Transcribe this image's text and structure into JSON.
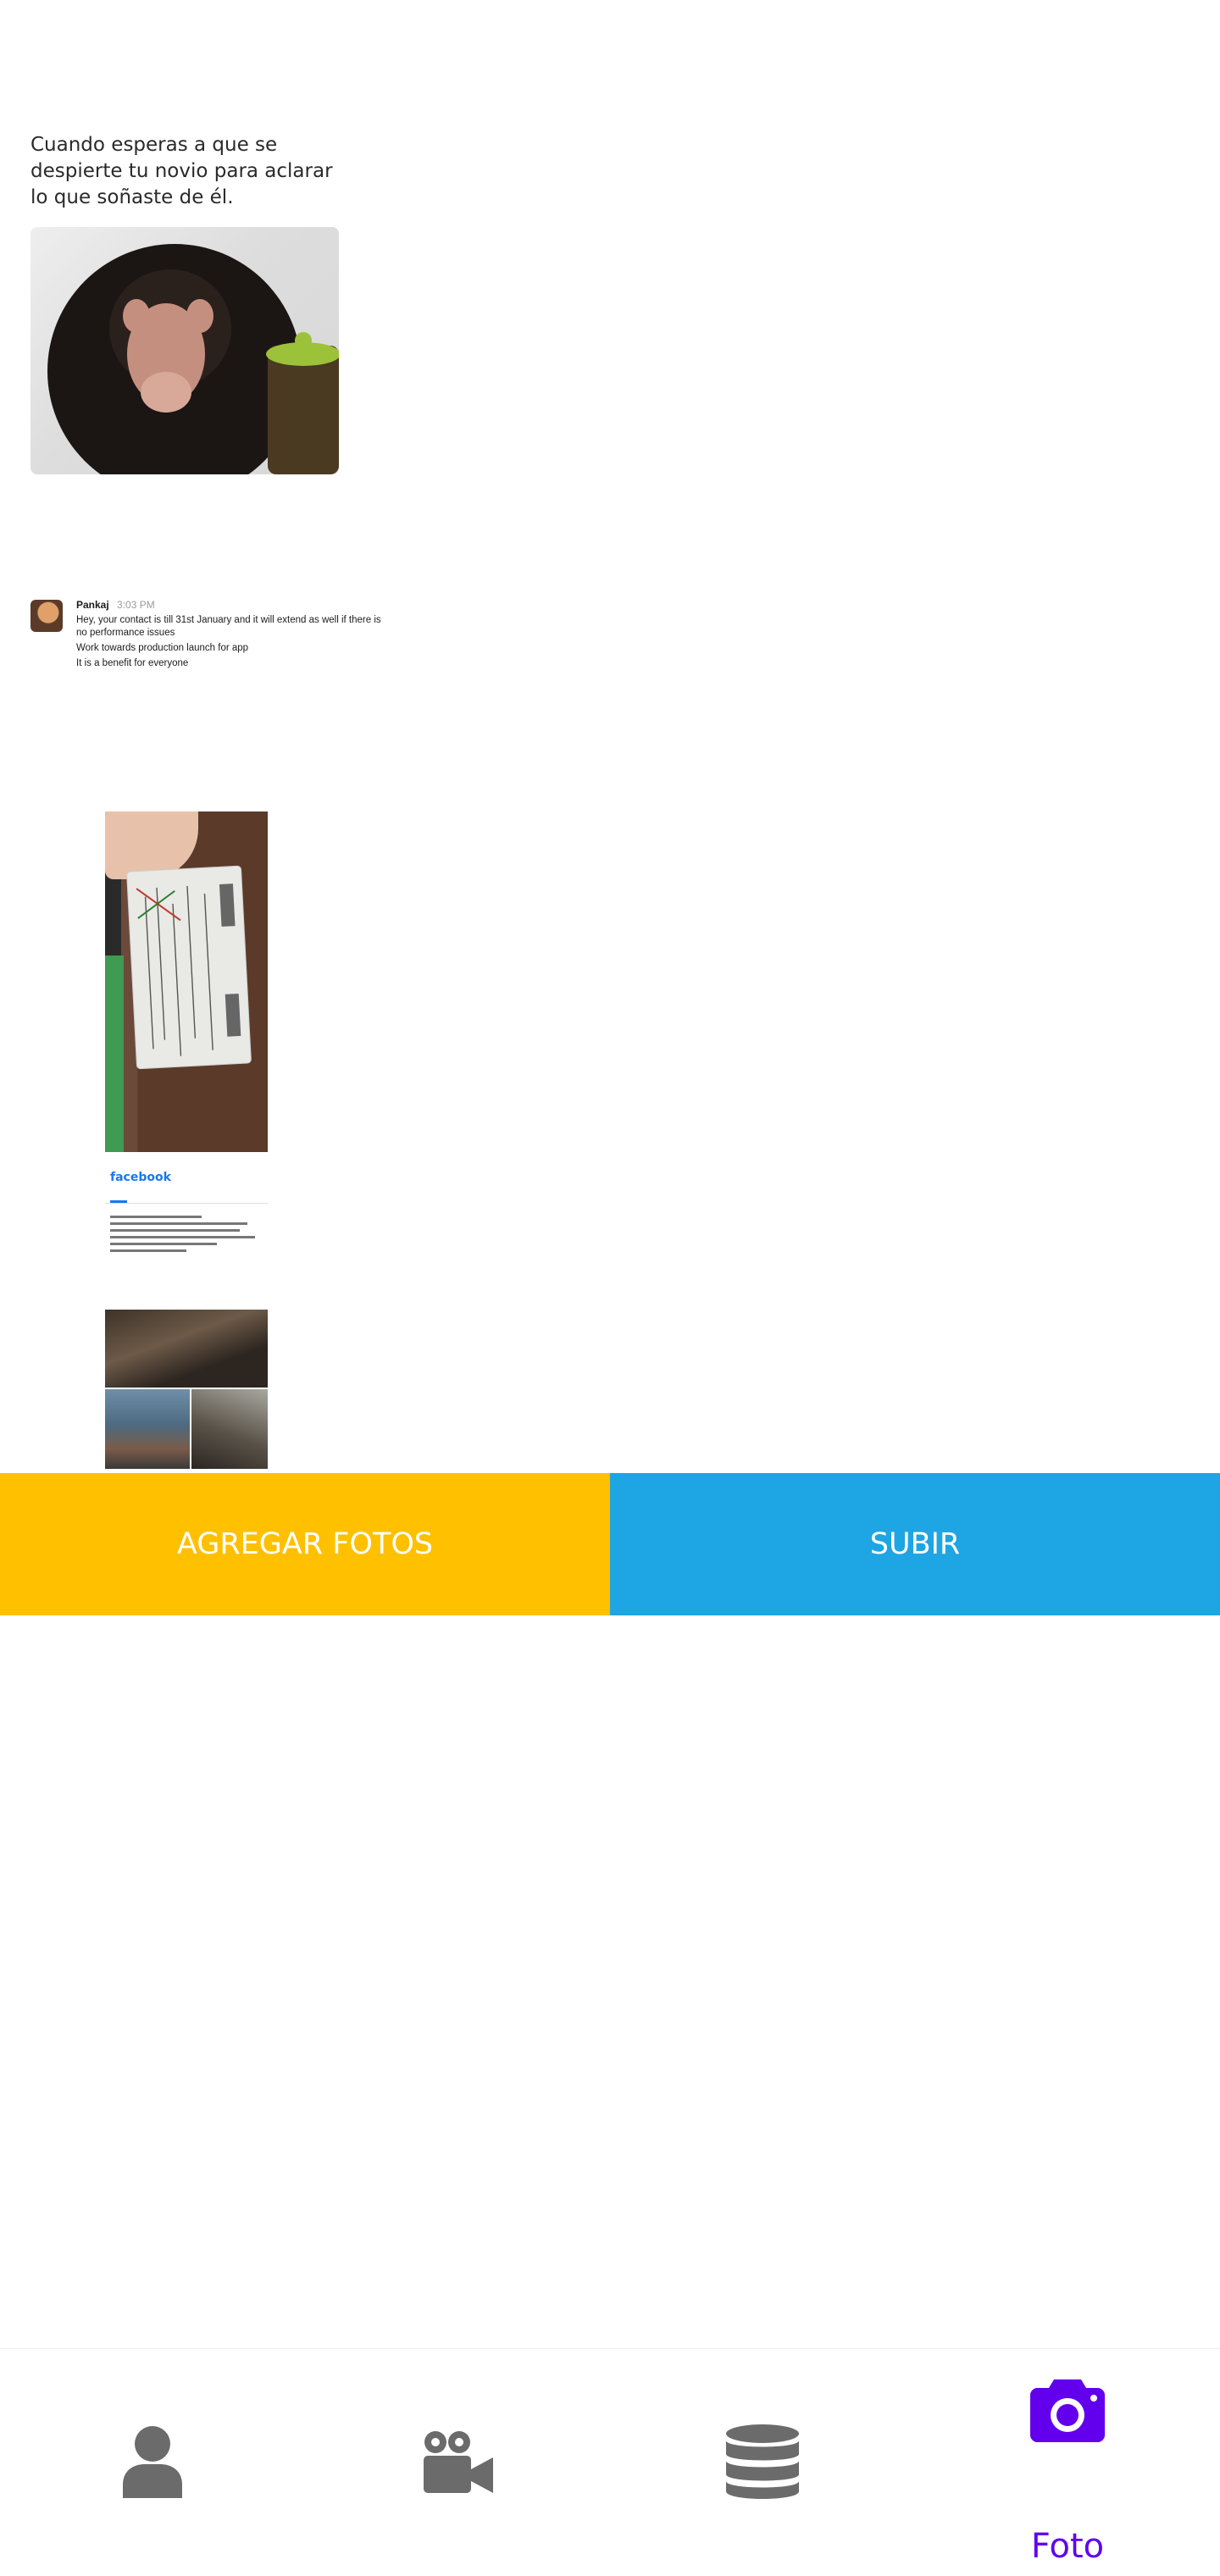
{
  "tweet": {
    "text": "Cuando esperas a que se despierte tu novio para aclarar lo que soñaste de él."
  },
  "slack": {
    "name": "Pankaj",
    "time": "3:03 PM",
    "messages": [
      "Hey, your contact is till 31st January and it will extend as well if there is no performance issues",
      "Work towards production launch for app",
      "It is a benefit for everyone"
    ]
  },
  "facebook": {
    "logo": "facebook"
  },
  "buttons": {
    "add_photos": "AGREGAR FOTOS",
    "upload": "SUBIR"
  },
  "nav": {
    "items": [
      {
        "icon": "user-icon",
        "label": ""
      },
      {
        "icon": "video-camera-icon",
        "label": ""
      },
      {
        "icon": "database-icon",
        "label": ""
      },
      {
        "icon": "camera-icon",
        "label": "Foto"
      }
    ],
    "active_color": "#6200ee",
    "inactive_color": "#6b6b6b"
  },
  "colors": {
    "add_button": "#ffc000",
    "upload_button": "#1ea5e3"
  }
}
